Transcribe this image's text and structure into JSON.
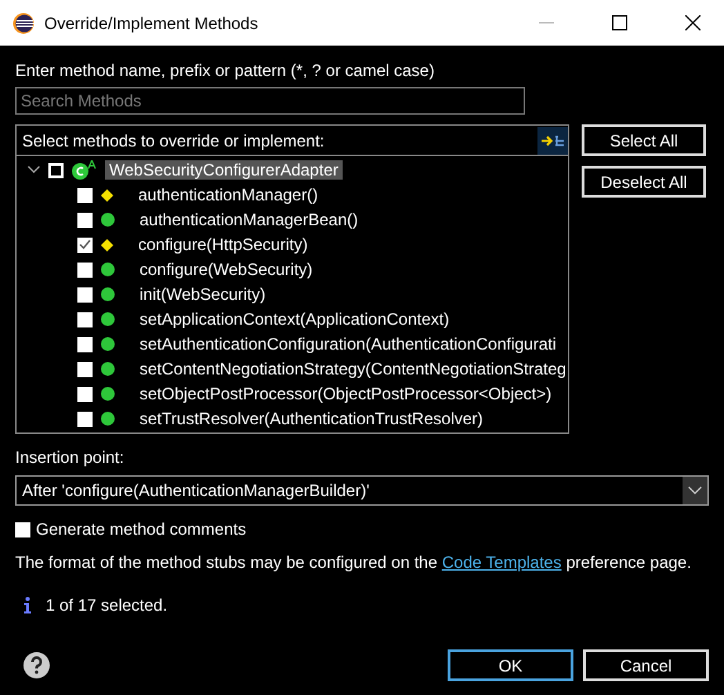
{
  "window": {
    "title": "Override/Implement Methods"
  },
  "filter": {
    "label": "Enter method name, prefix or pattern (*, ? or camel case)",
    "placeholder": "Search Methods"
  },
  "tree": {
    "header": "Select methods to override or implement:",
    "root": {
      "label": "WebSecurityConfigurerAdapter",
      "checked": false,
      "expanded": true,
      "selected": true,
      "children": [
        {
          "label": "authenticationManager()",
          "checked": false,
          "kind": "diamond"
        },
        {
          "label": "authenticationManagerBean()",
          "checked": false,
          "kind": "circle"
        },
        {
          "label": "configure(HttpSecurity)",
          "checked": true,
          "kind": "diamond"
        },
        {
          "label": "configure(WebSecurity)",
          "checked": false,
          "kind": "circle"
        },
        {
          "label": "init(WebSecurity)",
          "checked": false,
          "kind": "circle"
        },
        {
          "label": "setApplicationContext(ApplicationContext)",
          "checked": false,
          "kind": "circle"
        },
        {
          "label": "setAuthenticationConfiguration(AuthenticationConfigurati",
          "checked": false,
          "kind": "circle"
        },
        {
          "label": "setContentNegotiationStrategy(ContentNegotiationStrateg",
          "checked": false,
          "kind": "circle"
        },
        {
          "label": "setObjectPostProcessor(ObjectPostProcessor<Object>)",
          "checked": false,
          "kind": "circle"
        },
        {
          "label": "setTrustResolver(AuthenticationTrustResolver)",
          "checked": false,
          "kind": "circle"
        }
      ]
    }
  },
  "side_buttons": [
    "Select All",
    "Deselect All"
  ],
  "insertion": {
    "label": "Insertion point:",
    "value": "After 'configure(AuthenticationManagerBuilder)'"
  },
  "generate_comments": {
    "label": "Generate method comments",
    "checked": false
  },
  "note": {
    "before": "The format of the method stubs may be configured on the",
    "link": "Code Templates",
    "after": "preference page."
  },
  "status": "1 of 17 selected.",
  "buttons": [
    "OK",
    "Cancel"
  ]
}
